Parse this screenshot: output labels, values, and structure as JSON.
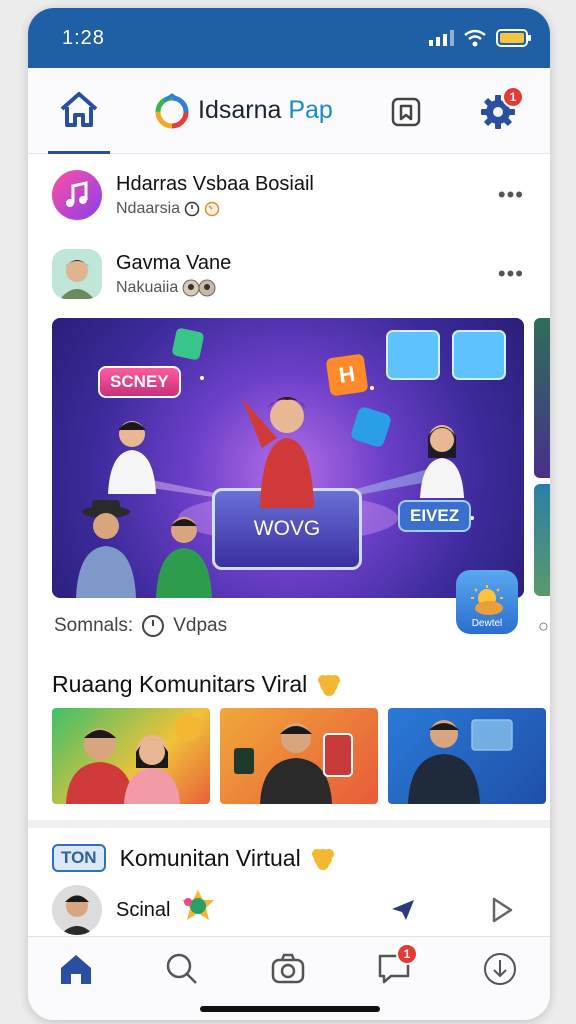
{
  "status_bar": {
    "time": "1:28"
  },
  "header": {
    "brand_part1": "Idsarna",
    "brand_part2": "Pap",
    "notification_count": "1"
  },
  "feed": {
    "row1": {
      "title": "Hdarras Vsbaa Bosiail",
      "subtitle": "Ndaarsia"
    },
    "row2": {
      "title": "Gavma Vane",
      "subtitle": "Nakuaiia"
    }
  },
  "banner": {
    "labels": {
      "left": "SCNEY",
      "right": "EIVEZ",
      "center": "WOVG",
      "cube": "H"
    }
  },
  "weather_widget": {
    "label": "Dewtel"
  },
  "caption": {
    "left": "Somnals:",
    "right": "Vdpas"
  },
  "section1": {
    "title": "Ruaang Komunitars Viral"
  },
  "section2": {
    "badge": "TON",
    "title": "Komunitan Virtual"
  },
  "post": {
    "name": "Scinal"
  },
  "bottom_nav": {
    "messages_badge": "1"
  }
}
